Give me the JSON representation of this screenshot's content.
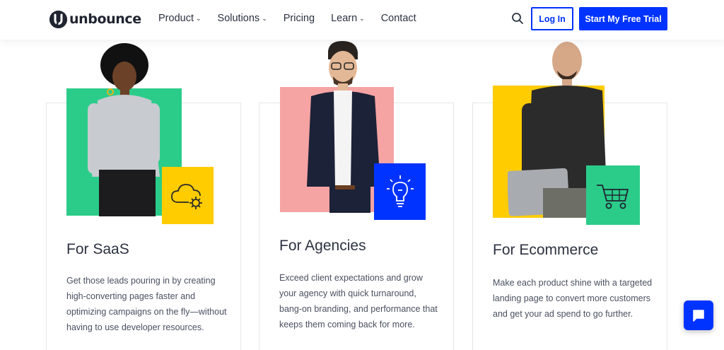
{
  "brand": {
    "name": "unbounce"
  },
  "nav": {
    "items": [
      {
        "label": "Product",
        "has_dropdown": true
      },
      {
        "label": "Solutions",
        "has_dropdown": true
      },
      {
        "label": "Pricing",
        "has_dropdown": false
      },
      {
        "label": "Learn",
        "has_dropdown": true
      },
      {
        "label": "Contact",
        "has_dropdown": false
      }
    ],
    "dropdown_glyph": "⌄",
    "search_icon": "search-icon",
    "login_label": "Log In",
    "trial_label": "Start My Free Trial"
  },
  "cards": [
    {
      "title": "For SaaS",
      "description": "Get those leads pouring in by creating high-converting pages faster and optimizing campaigns on the fly—without having to use developer resources.",
      "block_color": "#2bcc8a",
      "badge_color": "#ffcc00",
      "badge_icon": "cloud-gear-icon"
    },
    {
      "title": "For Agencies",
      "description": "Exceed client expectations and grow your agency with quick turnaround, bang-on branding, and performance that keeps them coming back for more.",
      "block_color": "#f5a3a3",
      "badge_color": "#0033ff",
      "badge_icon": "lightbulb-icon"
    },
    {
      "title": "For Ecommerce",
      "description": "Make each product shine with a targeted landing page to convert more customers and get your ad spend to go further.",
      "block_color": "#ffcc00",
      "badge_color": "#2bcc8a",
      "badge_icon": "shopping-cart-icon"
    }
  ],
  "chat": {
    "icon": "chat-bubble-icon"
  },
  "colors": {
    "accent": "#0033ff",
    "text_dark": "#1f2430",
    "card_border": "#e4e6ea"
  }
}
